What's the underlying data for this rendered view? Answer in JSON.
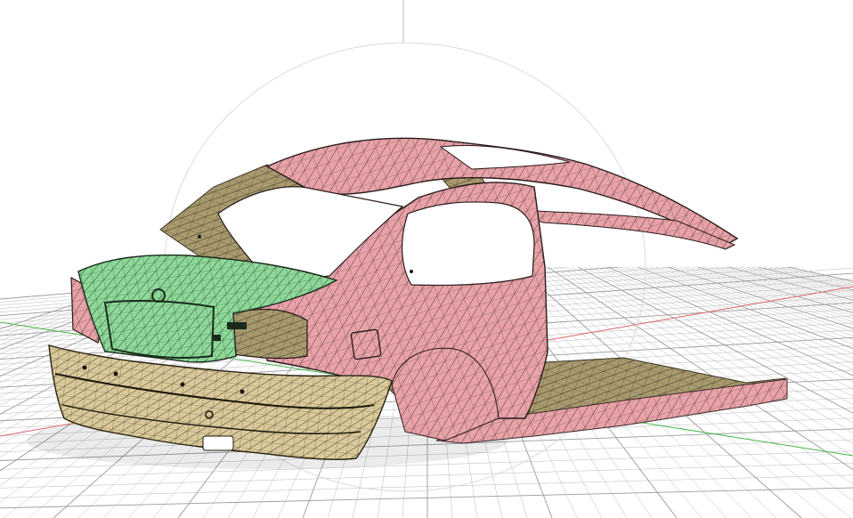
{
  "viewport": {
    "background": "#ffffff",
    "grid_color": "#b9b9b9",
    "grid_major_color": "#9a9a9a",
    "axis_colors": {
      "x": "#e06666",
      "z": "#4ab84a",
      "y": "#bdbdbd"
    },
    "orbit_ring_color": "#d9d9d9"
  },
  "model": {
    "description_icon": "car-body-mesh-icon",
    "colors": {
      "body_panel": "#e8a2a8",
      "trunk_lid": "#8ed99a",
      "interior_bumper": "#d9c99a",
      "interior_dark": "#a89a6e",
      "mesh_stroke": "#3a2a2a"
    }
  }
}
